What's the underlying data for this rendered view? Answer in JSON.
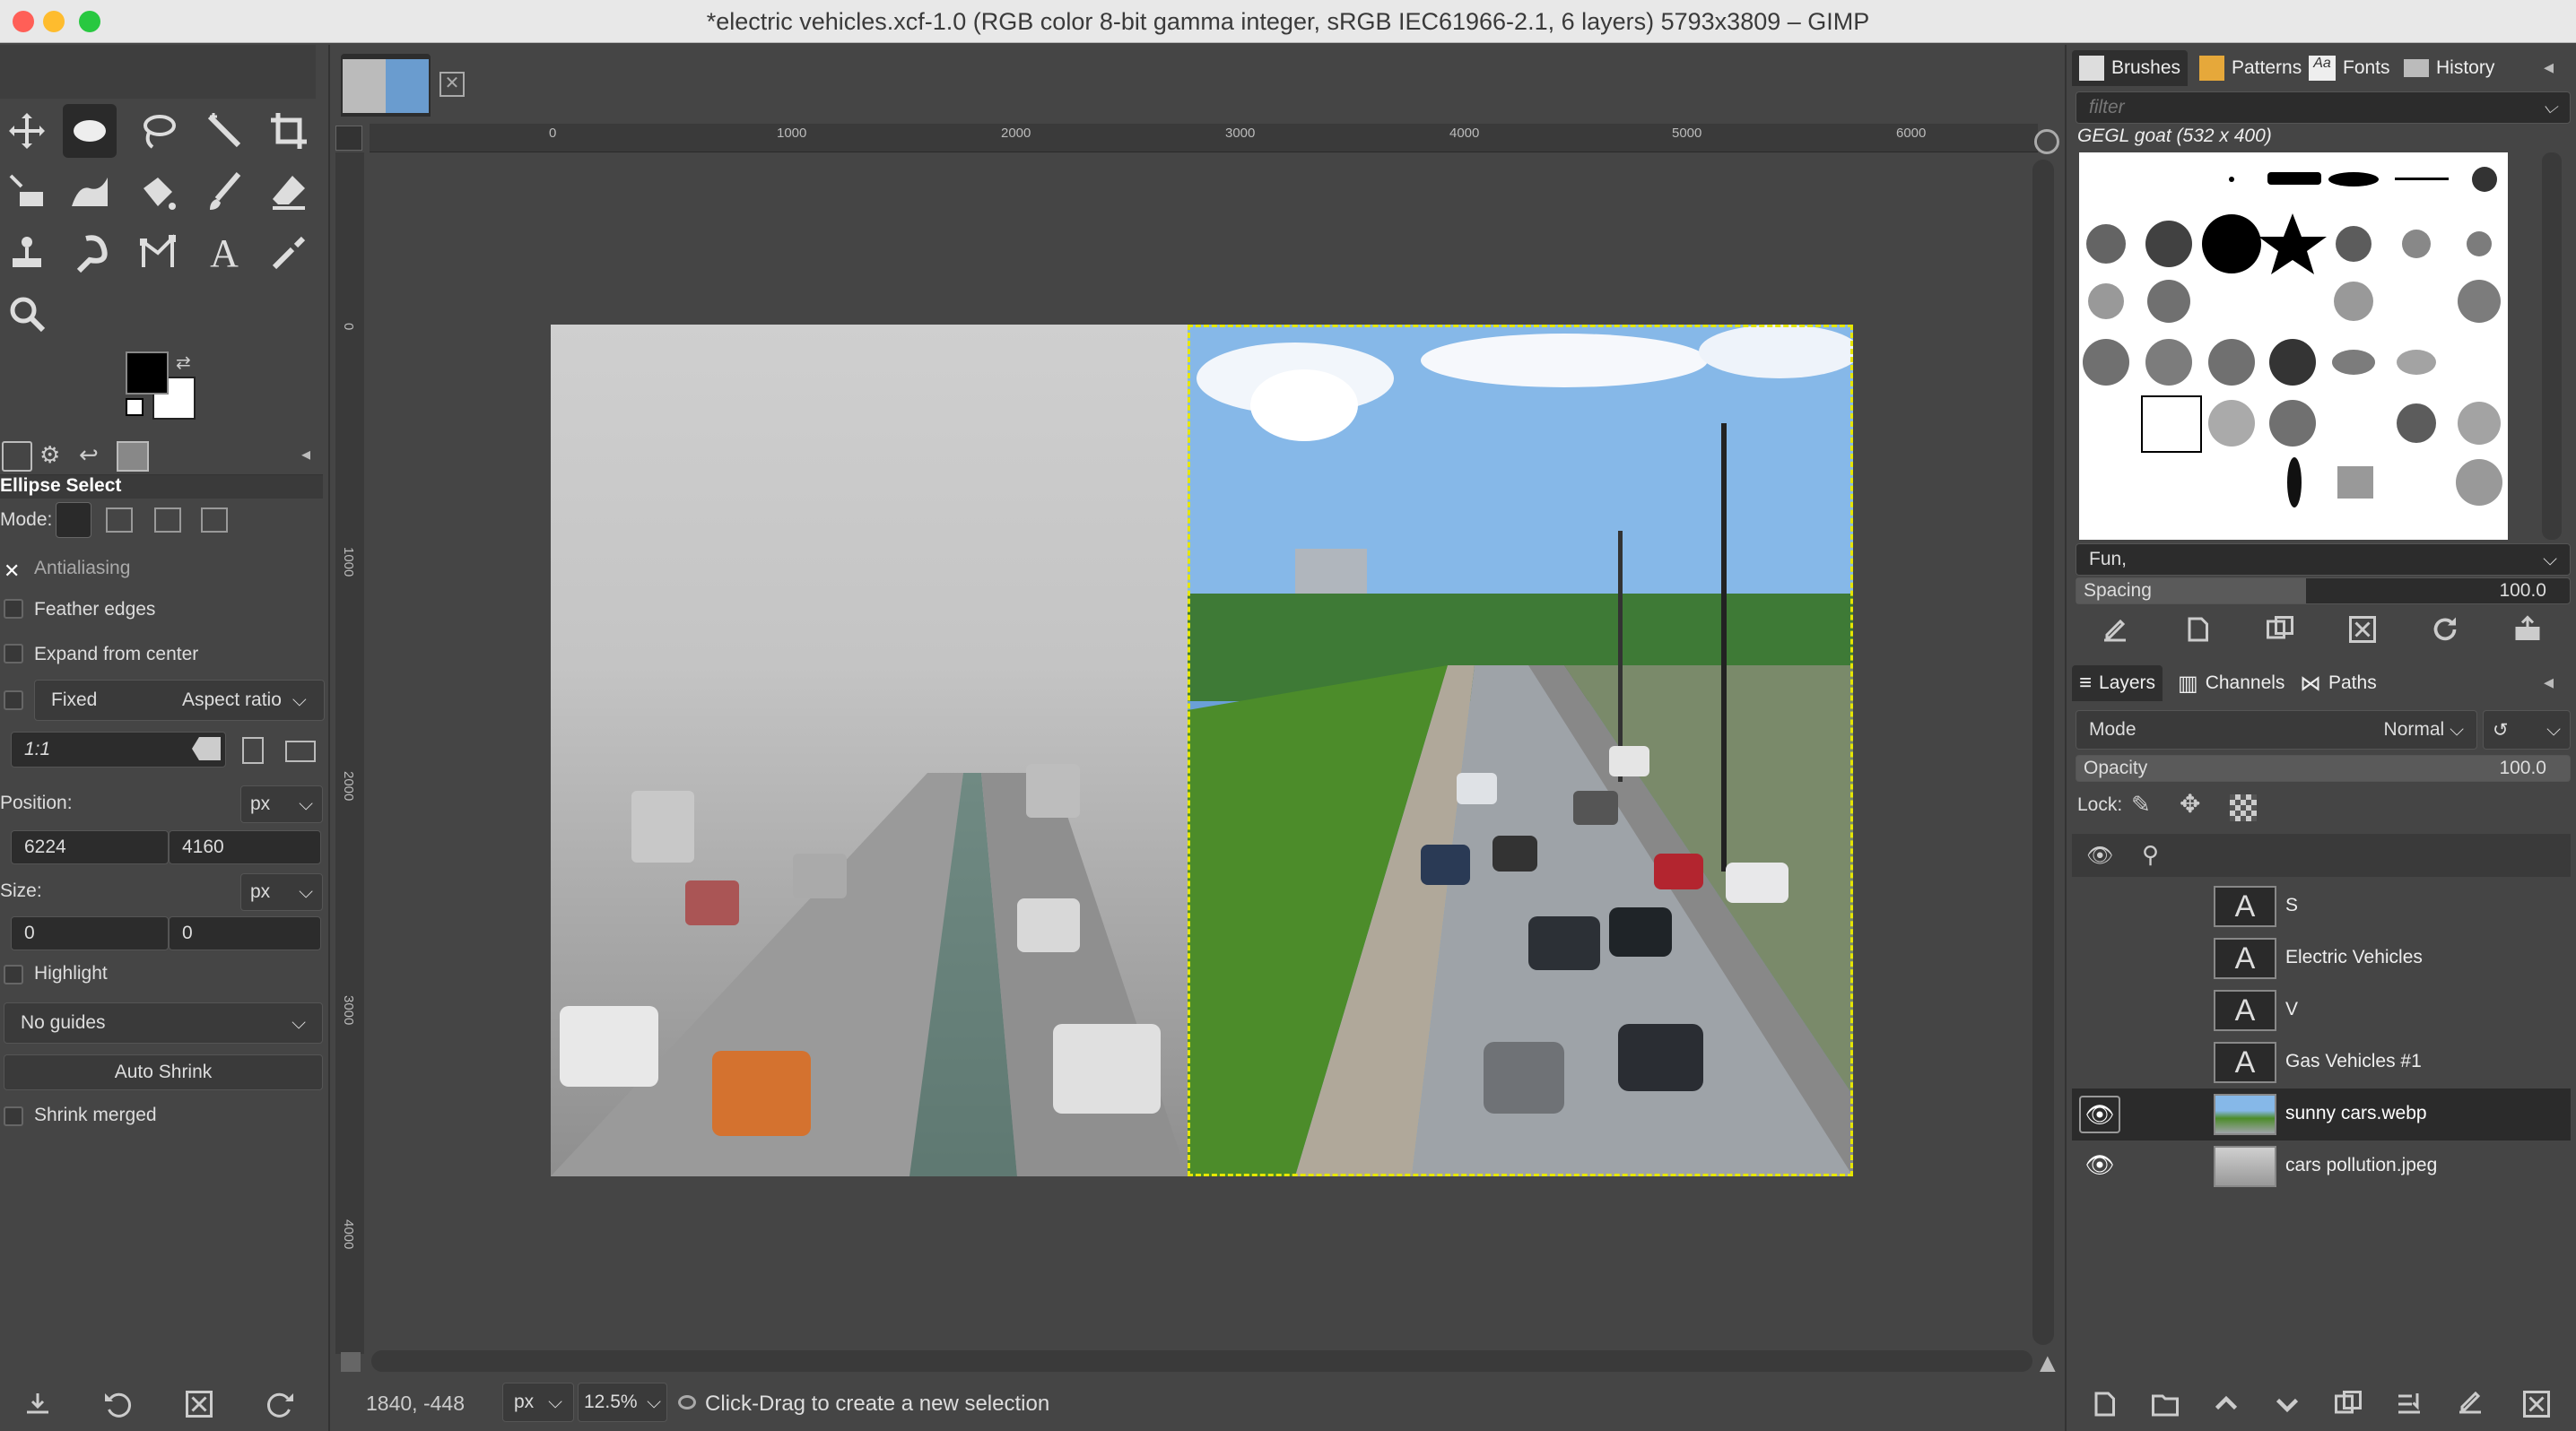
{
  "window": {
    "title": "*electric vehicles.xcf-1.0 (RGB color 8-bit gamma integer, sRGB IEC61966-2.1, 6 layers) 5793x3809 – GIMP"
  },
  "toolbox": {
    "tools": [
      "move-tool",
      "ellipse-select-tool",
      "free-select-tool",
      "fuzzy-select-tool",
      "crop-tool",
      "align-tool",
      "warp-transform-tool",
      "bucket-fill-tool",
      "paintbrush-tool",
      "eraser-tool",
      "clone-tool",
      "smudge-tool",
      "paths-tool",
      "text-tool",
      "color-picker-tool",
      "zoom-tool"
    ],
    "fg_color": "#000000",
    "bg_color": "#ffffff"
  },
  "tool_options": {
    "title": "Ellipse Select",
    "mode_label": "Mode:",
    "antialiasing": "Antialiasing",
    "feather_edges": "Feather edges",
    "expand_from_center": "Expand from center",
    "fixed_label": "Fixed",
    "fixed_value": "Aspect ratio",
    "ratio": "1:1",
    "position_label": "Position:",
    "position_unit": "px",
    "position_x": "6224",
    "position_y": "4160",
    "size_label": "Size:",
    "size_unit": "px",
    "size_w": "0",
    "size_h": "0",
    "highlight": "Highlight",
    "guides": "No guides",
    "auto_shrink": "Auto Shrink",
    "shrink_merged": "Shrink merged"
  },
  "ruler": {
    "h_ticks": [
      "0",
      "1000",
      "2000",
      "3000",
      "4000",
      "5000",
      "6000"
    ],
    "v_ticks": [
      "0",
      "1000",
      "2000",
      "3000",
      "4000"
    ]
  },
  "status": {
    "coords": "1840, -448",
    "unit": "px",
    "zoom": "12.5%",
    "message": "Click-Drag to create a new selection"
  },
  "brushes_panel": {
    "tabs": [
      "Brushes",
      "Patterns",
      "Fonts",
      "History"
    ],
    "filter_placeholder": "filter",
    "brush_name": "GEGL goat (532 x 400)",
    "tag": "Fun,",
    "spacing_label": "Spacing",
    "spacing_value": "100.0"
  },
  "layers_panel": {
    "tabs": [
      "Layers",
      "Channels",
      "Paths"
    ],
    "mode_label": "Mode",
    "mode_value": "Normal",
    "opacity_label": "Opacity",
    "opacity_value": "100.0",
    "lock_label": "Lock:",
    "layers": [
      {
        "name": "S",
        "type": "text",
        "visible": false
      },
      {
        "name": "Electric Vehicles",
        "type": "text",
        "visible": false
      },
      {
        "name": "V",
        "type": "text",
        "visible": false
      },
      {
        "name": "Gas Vehicles #1",
        "type": "text",
        "visible": false
      },
      {
        "name": "sunny cars.webp",
        "type": "image",
        "visible": true
      },
      {
        "name": "cars pollution.jpeg",
        "type": "image",
        "visible": true
      }
    ]
  },
  "colors": {
    "selection": "#e6e600",
    "accent": "#ffffff"
  }
}
